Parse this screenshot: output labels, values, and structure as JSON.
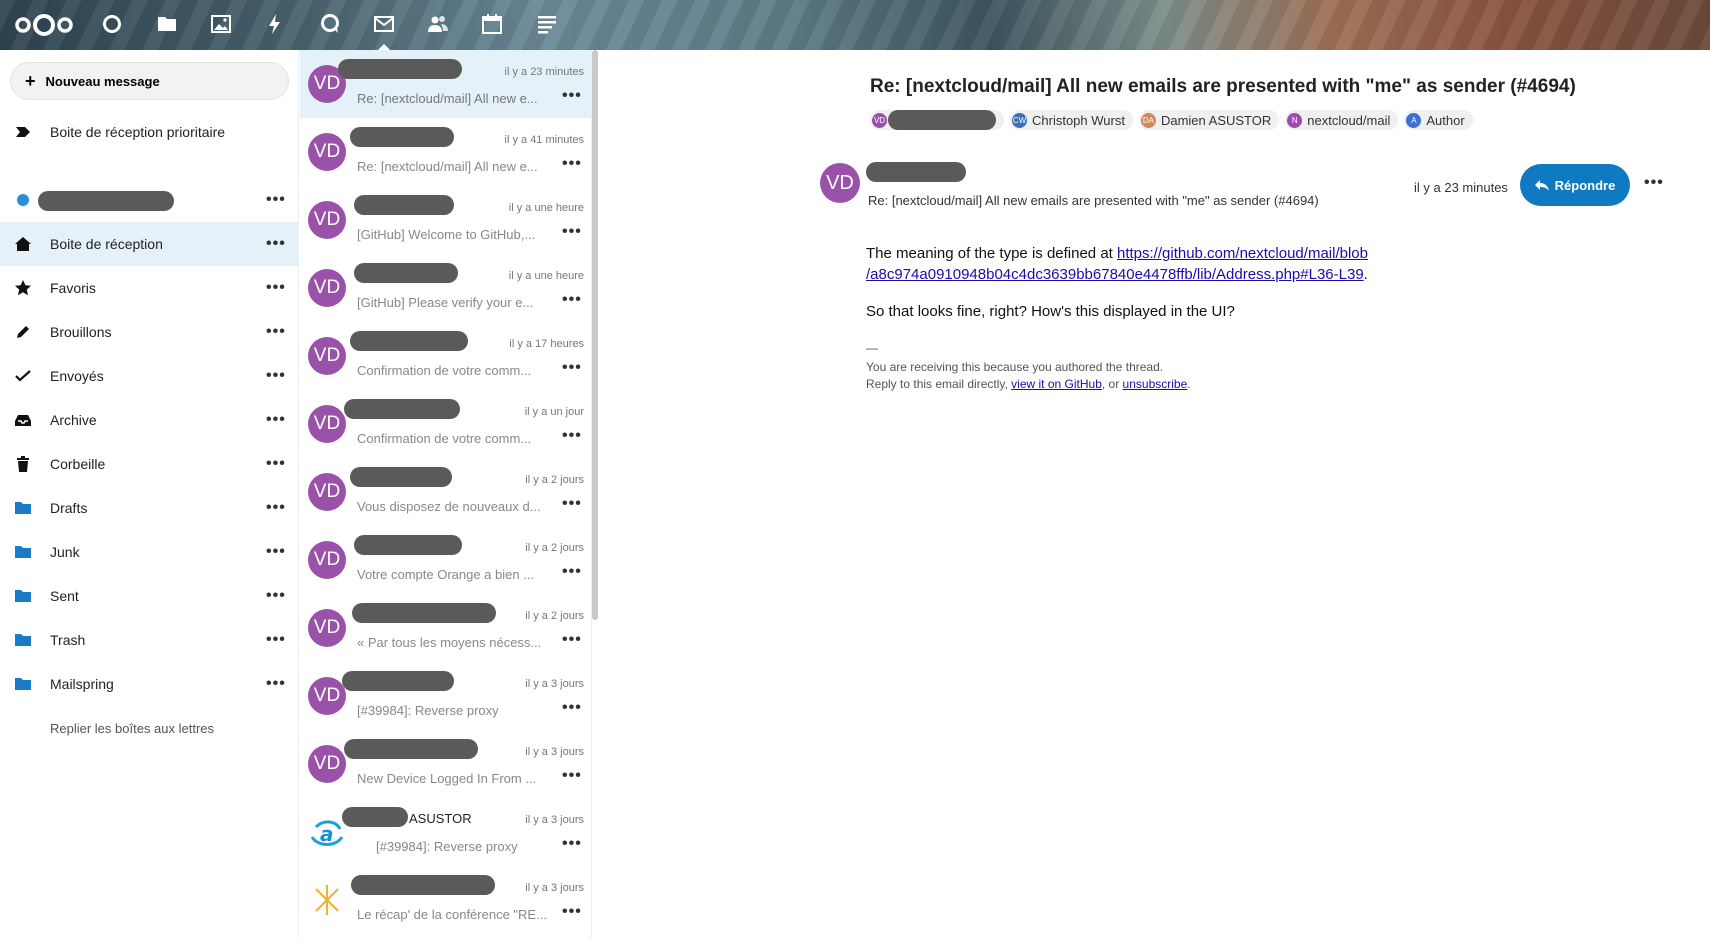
{
  "topbar": {
    "apps": [
      "dashboard-icon",
      "files-icon",
      "photos-icon",
      "activity-icon",
      "talk-icon",
      "mail-icon",
      "contacts-icon",
      "calendar-icon",
      "notes-icon"
    ],
    "active_app": "mail-icon"
  },
  "nav": {
    "new_message": "Nouveau message",
    "priority_inbox": "Boite de réception prioritaire",
    "items": [
      {
        "label": "Boite de réception",
        "icon": "home-icon"
      },
      {
        "label": "Favoris",
        "icon": "star-icon"
      },
      {
        "label": "Brouillons",
        "icon": "pencil-icon"
      },
      {
        "label": "Envoyés",
        "icon": "check-icon"
      },
      {
        "label": "Archive",
        "icon": "archive-icon"
      },
      {
        "label": "Corbeille",
        "icon": "trash-icon"
      },
      {
        "label": "Drafts",
        "icon": "folder-icon"
      },
      {
        "label": "Junk",
        "icon": "folder-icon"
      },
      {
        "label": "Sent",
        "icon": "folder-icon"
      },
      {
        "label": "Trash",
        "icon": "folder-icon"
      },
      {
        "label": "Mailspring",
        "icon": "folder-icon"
      }
    ],
    "collapse": "Replier les boîtes aux lettres",
    "more": "•••"
  },
  "messages": [
    {
      "avatar": "VD",
      "time": "il y a 23 minutes",
      "subject": "Re: [nextcloud/mail] All new e..."
    },
    {
      "avatar": "VD",
      "time": "il y a 41 minutes",
      "subject": "Re: [nextcloud/mail] All new e..."
    },
    {
      "avatar": "VD",
      "time": "il y a une heure",
      "subject": "[GitHub] Welcome to GitHub,..."
    },
    {
      "avatar": "VD",
      "time": "il y a une heure",
      "subject": "[GitHub] Please verify your e..."
    },
    {
      "avatar": "VD",
      "time": "il y a 17 heures",
      "subject": "Confirmation de votre comm..."
    },
    {
      "avatar": "VD",
      "time": "il y a un jour",
      "subject": "Confirmation de votre comm..."
    },
    {
      "avatar": "VD",
      "time": "il y a 2 jours",
      "subject": "Vous disposez de nouveaux d..."
    },
    {
      "avatar": "VD",
      "time": "il y a 2 jours",
      "subject": "Votre compte Orange a bien ..."
    },
    {
      "avatar": "VD",
      "time": "il y a 2 jours",
      "subject": "« Par tous les moyens nécess..."
    },
    {
      "avatar": "VD",
      "time": "il y a 3 jours",
      "subject": "[#39984]: Reverse proxy"
    },
    {
      "avatar": "VD",
      "time": "il y a 3 jours",
      "subject": "New Device Logged In From ..."
    },
    {
      "avatar": "a",
      "time": "il y a 3 jours",
      "subject": "[#39984]: Reverse proxy",
      "sender_suffix": "ASUSTOR"
    },
    {
      "avatar": "x",
      "time": "il y a 3 jours",
      "subject": "Le récap' de la conférence \"RE..."
    }
  ],
  "reader": {
    "title": "Re: [nextcloud/mail] All new emails are presented with \"me\" as sender (#4694)",
    "participants": [
      {
        "initials": "VD",
        "name": "",
        "color": "#9a52a8"
      },
      {
        "initials": "CW",
        "name": "Christoph Wurst",
        "color": "#3d6fb6"
      },
      {
        "initials": "DA",
        "name": "Damien ASUSTOR",
        "color": "#d08a5a"
      },
      {
        "initials": "N",
        "name": "nextcloud/mail",
        "color": "#a049b5"
      },
      {
        "initials": "A",
        "name": "Author",
        "color": "#3b6fd6"
      }
    ],
    "avatar": "VD",
    "subject": "Re: [nextcloud/mail] All new emails are presented with \"me\" as sender (#4694)",
    "time": "il y a 23 minutes",
    "reply": "Répondre",
    "body_line1_prefix": "The meaning of the type is defined at ",
    "body_link": "https://github.com/nextcloud/mail/blob/a8c974a0910948b04c4dc3639bb67840e4478ffb/lib/Address.php#L36-L39",
    "body_link_line1": "https://github.com/nextcloud/mail/blob",
    "body_link_line2": "/a8c974a0910948b04c4dc3639bb67840e4478ffb/lib/Address.php#L36-L39",
    "body_line2": "So that looks fine, right? How's this displayed in the UI?",
    "sig_dash": "—",
    "footer_line1": "You are receiving this because you authored the thread.",
    "footer_prefix": "Reply to this email directly, ",
    "footer_link1": "view it on GitHub",
    "footer_mid": ", or ",
    "footer_link2": "unsubscribe",
    "footer_end": "."
  }
}
